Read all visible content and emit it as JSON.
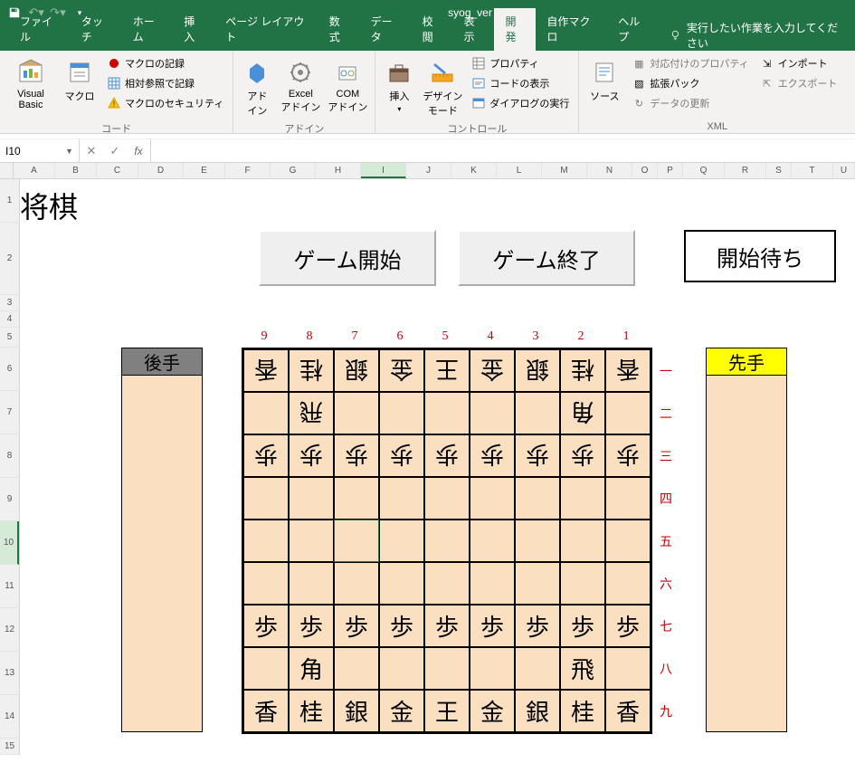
{
  "titlebar": {
    "filename": "syog_ver"
  },
  "menu": {
    "tabs": [
      "ファイル",
      "タッチ",
      "ホーム",
      "挿入",
      "ページ レイアウト",
      "数式",
      "データ",
      "校閲",
      "表示",
      "開発",
      "自作マクロ",
      "ヘルプ"
    ],
    "active": "開発",
    "tellme": "実行したい作業を入力してください"
  },
  "ribbon": {
    "code": {
      "vb": "Visual Basic",
      "macros": "マクロ",
      "rec": "マクロの記録",
      "rel": "相対参照で記録",
      "sec": "マクロのセキュリティ",
      "label": "コード"
    },
    "addins": {
      "addin": "アド\nイン",
      "excel": "Excel\nアドイン",
      "com": "COM\nアドイン",
      "label": "アドイン"
    },
    "controls": {
      "insert": "挿入",
      "design": "デザイン\nモード",
      "prop": "プロパティ",
      "code": "コードの表示",
      "dialog": "ダイアログの実行",
      "label": "コントロール"
    },
    "xml": {
      "source": "ソース",
      "map": "対応付けのプロパティ",
      "exp": "拡張パック",
      "ref": "データの更新",
      "imp": "インポート",
      "out": "エクスポート",
      "label": "XML"
    }
  },
  "formula": {
    "cell": "I10"
  },
  "cols": [
    "A",
    "B",
    "C",
    "D",
    "E",
    "F",
    "G",
    "H",
    "I",
    "J",
    "K",
    "L",
    "M",
    "N",
    "O",
    "P",
    "Q",
    "R",
    "S",
    "T",
    "U"
  ],
  "rows": [
    "1",
    "2",
    "3",
    "4",
    "5",
    "6",
    "7",
    "8",
    "9",
    "10",
    "11",
    "12",
    "13",
    "14",
    "15"
  ],
  "shogi": {
    "title": "将棋",
    "start": "ゲーム開始",
    "end": "ゲーム終了",
    "status": "開始待ち",
    "cols": [
      "9",
      "8",
      "7",
      "6",
      "5",
      "4",
      "3",
      "2",
      "1"
    ],
    "rows": [
      "一",
      "二",
      "三",
      "四",
      "五",
      "六",
      "七",
      "八",
      "九"
    ],
    "gote": "後手",
    "sente": "先手",
    "board": [
      [
        "香",
        "桂",
        "銀",
        "金",
        "王",
        "金",
        "銀",
        "桂",
        "香"
      ],
      [
        "",
        "飛",
        "",
        "",
        "",
        "",
        "",
        "角",
        ""
      ],
      [
        "歩",
        "歩",
        "歩",
        "歩",
        "歩",
        "歩",
        "歩",
        "歩",
        "歩"
      ],
      [
        "",
        "",
        "",
        "",
        "",
        "",
        "",
        "",
        ""
      ],
      [
        "",
        "",
        "",
        "",
        "",
        "",
        "",
        "",
        ""
      ],
      [
        "",
        "",
        "",
        "",
        "",
        "",
        "",
        "",
        ""
      ],
      [
        "歩",
        "歩",
        "歩",
        "歩",
        "歩",
        "歩",
        "歩",
        "歩",
        "歩"
      ],
      [
        "",
        "角",
        "",
        "",
        "",
        "",
        "",
        "飛",
        ""
      ],
      [
        "香",
        "桂",
        "銀",
        "金",
        "王",
        "金",
        "銀",
        "桂",
        "香"
      ]
    ]
  }
}
